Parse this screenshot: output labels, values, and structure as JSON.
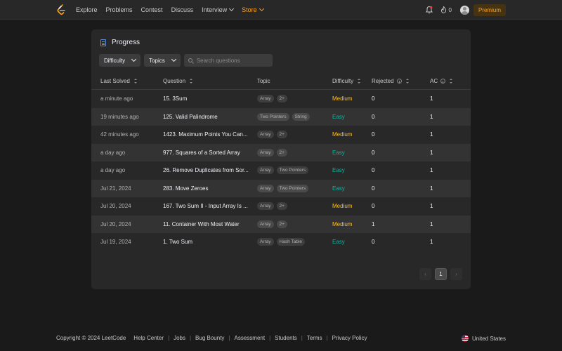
{
  "nav": {
    "links": [
      "Explore",
      "Problems",
      "Contest",
      "Discuss",
      "Interview",
      "Store"
    ],
    "streak_count": "0",
    "premium_label": "Premium",
    "colors": {
      "brand": "#ffa116",
      "easy": "#00b8a3",
      "medium": "#ffc01e"
    }
  },
  "progress": {
    "title": "Progress",
    "filters": {
      "difficulty": "Difficulty",
      "topics": "Topics"
    },
    "search": {
      "placeholder": "Search questions"
    },
    "columns": {
      "last_solved": "Last Solved",
      "question": "Question",
      "topic": "Topic",
      "difficulty": "Difficulty",
      "rejected": "Rejected",
      "ac": "AC"
    },
    "rows": [
      {
        "last": "a minute ago",
        "question": "15. 3Sum",
        "tags": [
          "Array",
          "2+"
        ],
        "difficulty": "Medium",
        "rejected": "0",
        "ac": "1"
      },
      {
        "last": "19 minutes ago",
        "question": "125. Valid Palindrome",
        "tags": [
          "Two Pointers",
          "String"
        ],
        "difficulty": "Easy",
        "rejected": "0",
        "ac": "1"
      },
      {
        "last": "42 minutes ago",
        "question": "1423. Maximum Points You Can...",
        "tags": [
          "Array",
          "2+"
        ],
        "difficulty": "Medium",
        "rejected": "0",
        "ac": "1"
      },
      {
        "last": "a day ago",
        "question": "977. Squares of a Sorted Array",
        "tags": [
          "Array",
          "2+"
        ],
        "difficulty": "Easy",
        "rejected": "0",
        "ac": "1"
      },
      {
        "last": "a day ago",
        "question": "26. Remove Duplicates from Sor...",
        "tags": [
          "Array",
          "Two Pointers"
        ],
        "difficulty": "Easy",
        "rejected": "0",
        "ac": "1"
      },
      {
        "last": "Jul 21, 2024",
        "question": "283. Move Zeroes",
        "tags": [
          "Array",
          "Two Pointers"
        ],
        "difficulty": "Easy",
        "rejected": "0",
        "ac": "1"
      },
      {
        "last": "Jul 20, 2024",
        "question": "167. Two Sum II - Input Array Is ...",
        "tags": [
          "Array",
          "2+"
        ],
        "difficulty": "Medium",
        "rejected": "0",
        "ac": "1"
      },
      {
        "last": "Jul 20, 2024",
        "question": "11. Container With Most Water",
        "tags": [
          "Array",
          "2+"
        ],
        "difficulty": "Medium",
        "rejected": "1",
        "ac": "1"
      },
      {
        "last": "Jul 19, 2024",
        "question": "1. Two Sum",
        "tags": [
          "Array",
          "Hash Table"
        ],
        "difficulty": "Easy",
        "rejected": "0",
        "ac": "1"
      }
    ],
    "pagination": {
      "current": "1",
      "prev_icon": "chevron-left-icon",
      "next_icon": "chevron-right-icon"
    }
  },
  "footer": {
    "copyright": "Copyright © 2024 LeetCode",
    "links": [
      "Help Center",
      "Jobs",
      "Bug Bounty",
      "Assessment",
      "Students",
      "Terms",
      "Privacy Policy"
    ],
    "country": "United States"
  }
}
